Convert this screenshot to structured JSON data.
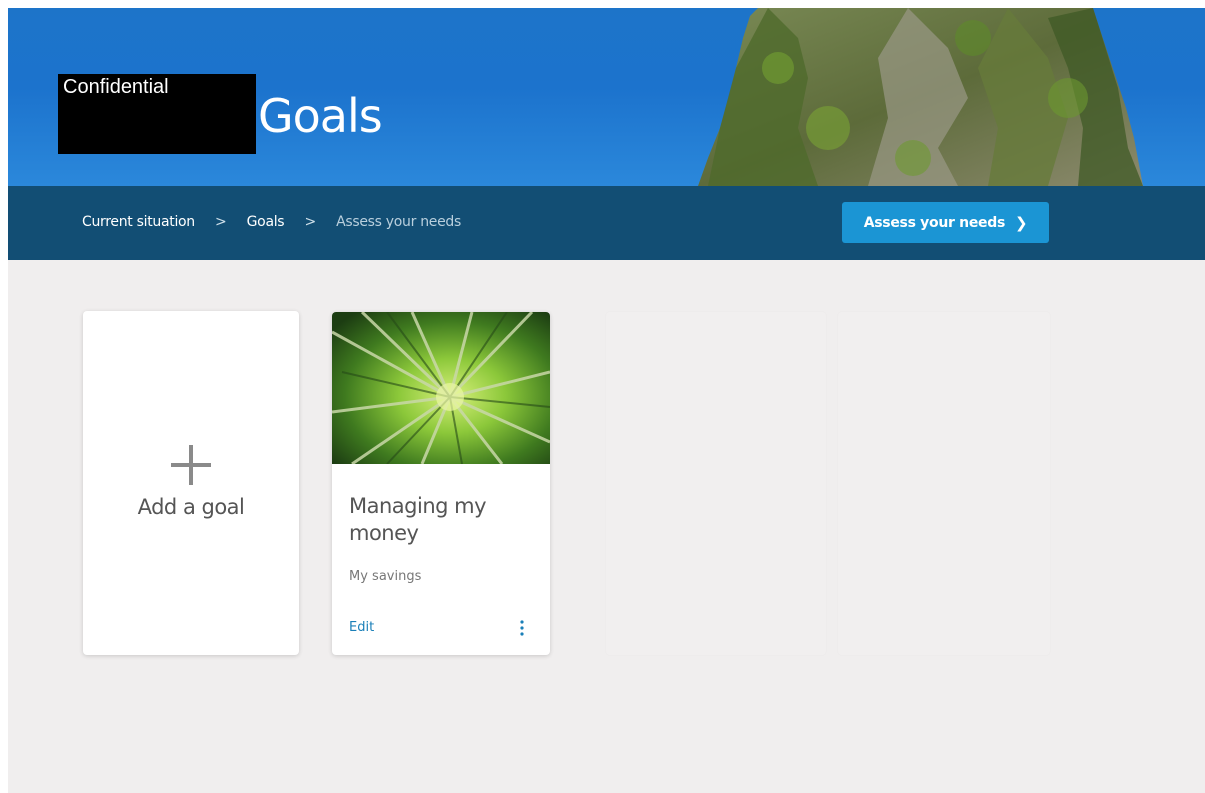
{
  "header": {
    "brand_text": "Confidential",
    "title": "Goals"
  },
  "breadcrumb": {
    "items": [
      {
        "label": "Current situation",
        "state": "completed"
      },
      {
        "label": "Goals",
        "state": "current"
      },
      {
        "label": "Assess your needs",
        "state": "upcoming"
      }
    ],
    "separator": ">"
  },
  "primary_action": {
    "label": "Assess your needs",
    "icon": "chevron-right-icon"
  },
  "cards": {
    "add": {
      "icon": "plus-icon",
      "label": "Add a goal"
    },
    "goal": {
      "title": "Managing my money",
      "subtitle": "My savings",
      "edit_label": "Edit",
      "menu_icon": "more-vertical-icon",
      "image": "bamboo-forest-photo"
    }
  },
  "colors": {
    "hero_blue": "#1d74c9",
    "nav_bar": "#124e74",
    "button_blue": "#1b95d4",
    "link_blue": "#1a7fb8",
    "background": "#f0eeee"
  }
}
